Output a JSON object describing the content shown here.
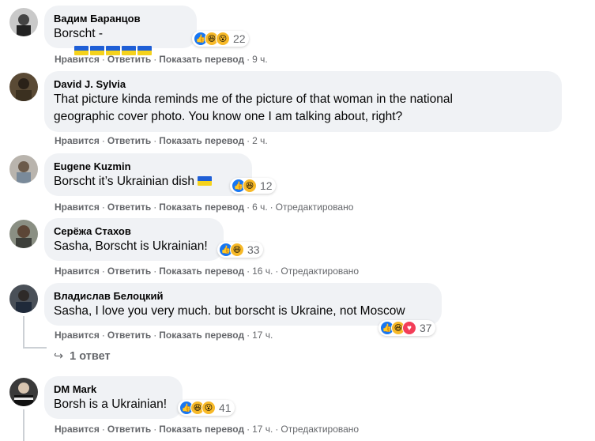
{
  "comments": [
    {
      "author": "Вадим Баранцов",
      "text": "Borscht -",
      "flags": 5,
      "reaction_count": "22",
      "time": "9 ч.",
      "edited": ""
    },
    {
      "author": "David J. Sylvia",
      "text": "That picture kinda reminds me of the picture of that woman in the national\ngeographic cover photo. You know one I am talking about, right?",
      "time": "2 ч.",
      "edited": ""
    },
    {
      "author": "Eugene Kuzmin",
      "text": "Borscht it’s Ukrainian dish",
      "flags": 1,
      "reaction_count": "12",
      "time": "6 ч.",
      "edited": "Отредактировано"
    },
    {
      "author": "Серёжа Стахов",
      "text": "Sasha, Borscht is Ukrainian!",
      "reaction_count": "33",
      "time": "16 ч.",
      "edited": "Отредактировано"
    },
    {
      "author": "Владислав Белоцкий",
      "text": "Sasha, I love you very much. but borscht is Ukraine, not Moscow",
      "reaction_count": "37",
      "time": "17 ч.",
      "edited": ""
    },
    {
      "author": "DM Mark",
      "text": "Borsh is a Ukrainian!",
      "reaction_count": "41",
      "time": "17 ч.",
      "edited": "Отредактировано"
    }
  ],
  "actions": {
    "like": "Нравится",
    "reply": "Ответить",
    "translate": "Показать перевод",
    "dot": "·"
  },
  "replies_link": "1 ответ",
  "icons": {
    "like": "like-icon",
    "haha": "haha-icon",
    "love": "love-icon",
    "wow": "wow-icon",
    "reply_arrow": "reply-arrow-icon"
  },
  "colors": {
    "bubble": "#f0f2f5",
    "meta": "#65676b",
    "like": "#1877f2",
    "haha": "#f7b928",
    "love": "#f33e58"
  }
}
